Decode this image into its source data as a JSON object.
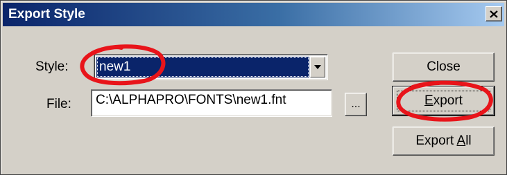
{
  "window": {
    "title": "Export Style",
    "close_glyph": "✕",
    "close_icon": "close-icon"
  },
  "form": {
    "style_label": "Style:",
    "style_value": "new1",
    "file_label": "File:",
    "file_value": "C:\\ALPHAPRO\\FONTS\\new1.fnt",
    "browse_label": "..."
  },
  "buttons": {
    "close_label": "Close",
    "export_prefix": "",
    "export_mnemonic": "E",
    "export_rest": "xport",
    "export_all_prefix": "Export ",
    "export_all_mnemonic": "A",
    "export_all_rest": "ll"
  },
  "annotations": {
    "color": "#e8141a"
  },
  "colors": {
    "title_bar_start": "#0a246a",
    "title_bar_end": "#a6caf0",
    "dialog_face": "#d4d0c8",
    "selection": "#0a246a"
  }
}
